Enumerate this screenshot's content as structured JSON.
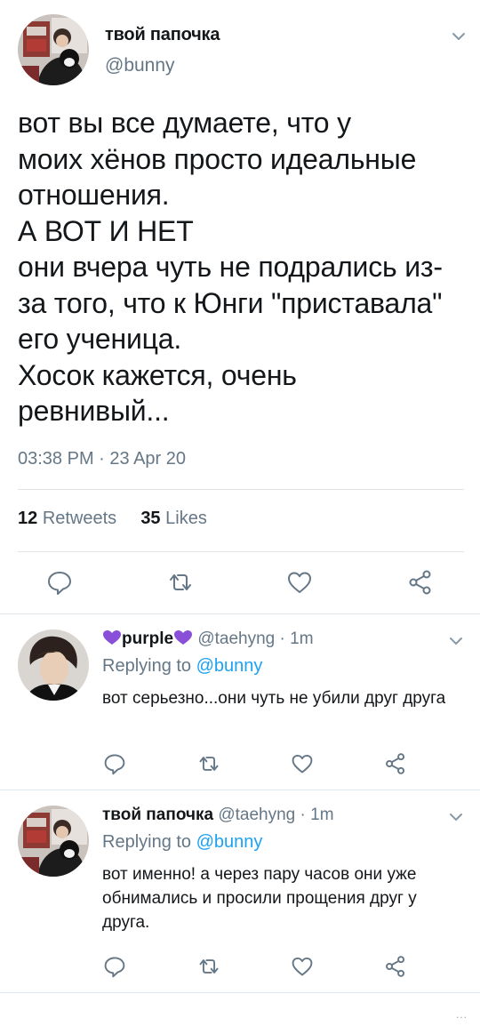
{
  "main_tweet": {
    "display_name": "твой папочка",
    "handle": "@bunny",
    "text": "вот вы все думаете, что у\nмоих хёнов просто идеальные\nотношения.\nА ВОТ И НЕТ\nони вчера чуть не подрались из-\nза того, что к Юнги \"приставала\"\nего ученица.\nХосок кажется, очень\nревнивый...",
    "timestamp": "03:38 PM · 23 Apr 20",
    "retweets_count": "12",
    "retweets_label": "Retweets",
    "likes_count": "35",
    "likes_label": "Likes"
  },
  "replies": [
    {
      "display_name": "purple",
      "handle_time": "@taehyng · 1m",
      "replying_prefix": "Replying to ",
      "replying_to": "@bunny",
      "text": "вот серьезно...они чуть не убили друг друга"
    },
    {
      "display_name": "твой папочка",
      "handle_time": "@taehyng · 1m",
      "replying_prefix": "Replying to ",
      "replying_to": "@bunny",
      "text": "вот именно! а через пару часов они уже обнимались и просили прощения друг у друга."
    }
  ],
  "footer_ellipsis": "...",
  "colors": {
    "accent": "#1da1f2",
    "secondary_text": "#657786",
    "icon": "#657786",
    "heart_emoji": "#8a4fd8"
  },
  "icons": [
    "chevron-down-icon",
    "reply-icon",
    "retweet-icon",
    "like-icon",
    "share-icon",
    "purple-heart-icon"
  ]
}
